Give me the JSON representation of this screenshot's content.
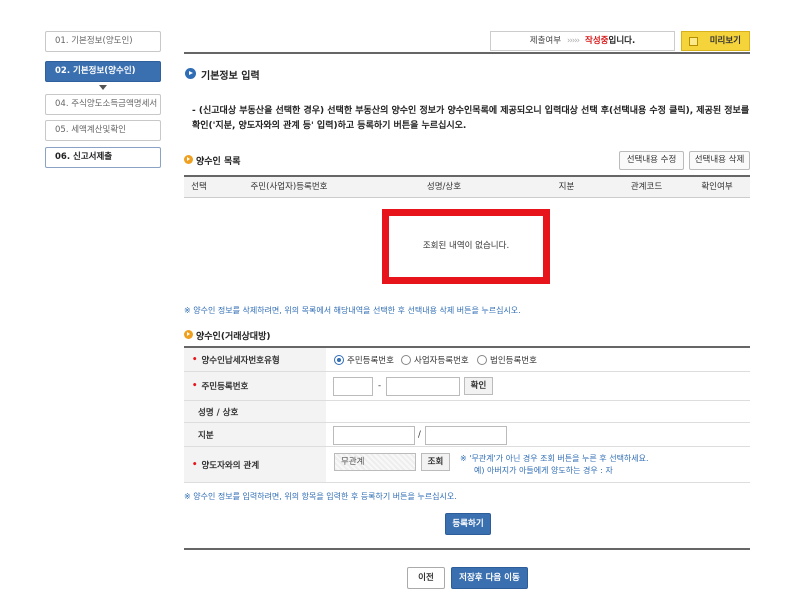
{
  "sidebar": {
    "items": [
      {
        "label": "01. 기본정보(양도인)"
      },
      {
        "label": "02. 기본정보(양수인)"
      },
      {
        "label": "04. 주식양도소득금액명세서"
      },
      {
        "label": "05. 세액계산및확인"
      },
      {
        "label": "06. 신고서제출"
      }
    ]
  },
  "header": {
    "status_label": "제출여부",
    "status_arrows": "›››››",
    "status_value": "작성중",
    "status_suffix": "입니다.",
    "preview_label": "미리보기"
  },
  "section": {
    "title": "기본정보 입력",
    "notice": "- (신고대상 부동산을 선택한 경우) 선택한 부동산의 양수인 정보가 양수인목록에 제공되오니 입력대상 선택 후(선택내용 수정 클릭), 제공된 정보를 확인('지분, 양도자와의 관계 등' 입력)하고 등록하기 버튼을 누르십시오."
  },
  "list": {
    "title": "양수인 목록",
    "edit_button": "선택내용 수정",
    "delete_button": "선택내용 삭제",
    "columns": [
      "선택",
      "주민(사업자)등록번호",
      "성명/상호",
      "지분",
      "관계코드",
      "확인여부"
    ],
    "empty_message": "조회된 내역이 없습니다.",
    "note": "※ 양수인 정보를 삭제하려면, 위의 목록에서 해당내역을 선택한 후 선택내용 삭제 버튼을 누르십시오."
  },
  "form": {
    "title": "양수인(거래상대방)",
    "rows": {
      "type_label": "양수인납세자번호유형",
      "id_label": "주민등록번호",
      "name_label": "성명 / 상호",
      "share_label": "지분",
      "relation_label": "양도자와의 관계"
    },
    "radio_options": [
      "주민등록번호",
      "사업자등록번호",
      "법인등록번호"
    ],
    "id_separator": "-",
    "confirm_button": "확인",
    "share_separator": "/",
    "relation_value": "무관계",
    "lookup_button": "조회",
    "relation_hint_1": "※ '무관계'가 아닌 경우 조회 버튼을 누른 후 선택하세요.",
    "relation_hint_2": "예) 아버지가 아들에게 양도하는 경우 : 자",
    "note": "※ 양수인 정보를 입력하려면, 위의 항목을 입력한 후 등록하기 버튼을 누르십시오.",
    "register_button": "등록하기"
  },
  "footer": {
    "prev_button": "이전",
    "next_button": "저장후 다음 이동"
  }
}
